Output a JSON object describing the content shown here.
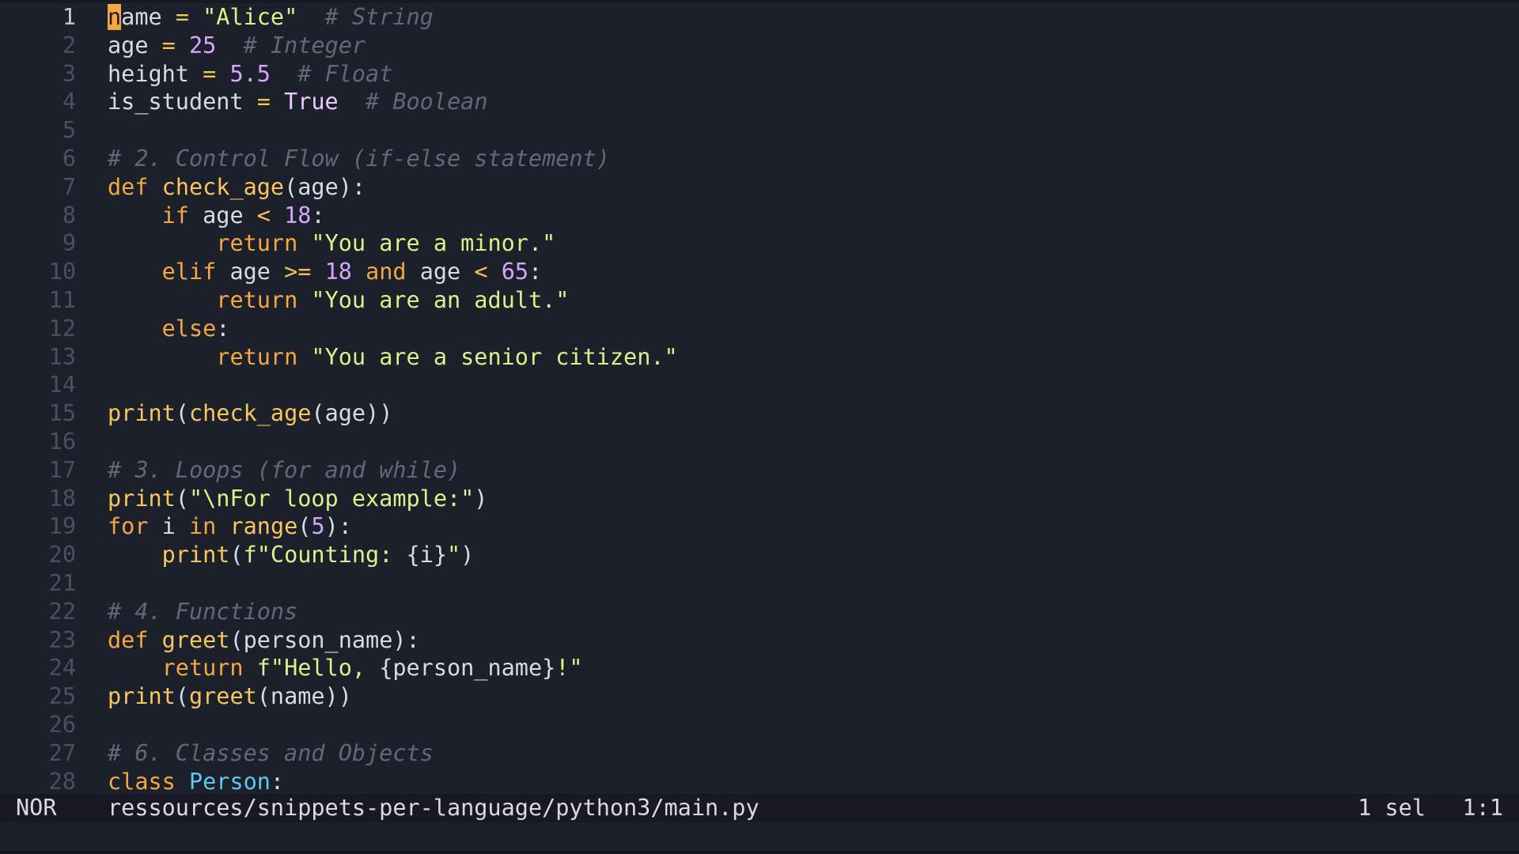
{
  "editor": {
    "lines": [
      {
        "n": "1",
        "tokens": [
          {
            "t": "n",
            "c": "cursor"
          },
          {
            "t": "ame",
            "c": "plain"
          },
          {
            "t": " = ",
            "c": "op"
          },
          {
            "t": "\"Alice\"",
            "c": "string"
          },
          {
            "t": "  ",
            "c": "plain"
          },
          {
            "t": "# String",
            "c": "comment"
          }
        ]
      },
      {
        "n": "2",
        "tokens": [
          {
            "t": "age",
            "c": "plain"
          },
          {
            "t": " = ",
            "c": "op"
          },
          {
            "t": "25",
            "c": "number"
          },
          {
            "t": "  ",
            "c": "plain"
          },
          {
            "t": "# Integer",
            "c": "comment"
          }
        ]
      },
      {
        "n": "3",
        "tokens": [
          {
            "t": "height",
            "c": "plain"
          },
          {
            "t": " = ",
            "c": "op"
          },
          {
            "t": "5.5",
            "c": "number"
          },
          {
            "t": "  ",
            "c": "plain"
          },
          {
            "t": "# Float",
            "c": "comment"
          }
        ]
      },
      {
        "n": "4",
        "tokens": [
          {
            "t": "is_student",
            "c": "plain"
          },
          {
            "t": " = ",
            "c": "op"
          },
          {
            "t": "True",
            "c": "const"
          },
          {
            "t": "  ",
            "c": "plain"
          },
          {
            "t": "# Boolean",
            "c": "comment"
          }
        ]
      },
      {
        "n": "5",
        "tokens": []
      },
      {
        "n": "6",
        "tokens": [
          {
            "t": "# 2. Control Flow (if-else statement)",
            "c": "comment"
          }
        ]
      },
      {
        "n": "7",
        "tokens": [
          {
            "t": "def",
            "c": "keyword"
          },
          {
            "t": " ",
            "c": "plain"
          },
          {
            "t": "check_age",
            "c": "func"
          },
          {
            "t": "(age):",
            "c": "plain"
          }
        ]
      },
      {
        "n": "8",
        "tokens": [
          {
            "t": "    ",
            "c": "plain"
          },
          {
            "t": "if",
            "c": "keyword"
          },
          {
            "t": " age ",
            "c": "plain"
          },
          {
            "t": "<",
            "c": "op"
          },
          {
            "t": " ",
            "c": "plain"
          },
          {
            "t": "18",
            "c": "number"
          },
          {
            "t": ":",
            "c": "plain"
          }
        ]
      },
      {
        "n": "9",
        "tokens": [
          {
            "t": "        ",
            "c": "plain"
          },
          {
            "t": "return",
            "c": "keyword"
          },
          {
            "t": " ",
            "c": "plain"
          },
          {
            "t": "\"You are a minor.\"",
            "c": "string"
          }
        ]
      },
      {
        "n": "10",
        "tokens": [
          {
            "t": "    ",
            "c": "plain"
          },
          {
            "t": "elif",
            "c": "keyword"
          },
          {
            "t": " age ",
            "c": "plain"
          },
          {
            "t": ">=",
            "c": "op"
          },
          {
            "t": " ",
            "c": "plain"
          },
          {
            "t": "18",
            "c": "number"
          },
          {
            "t": " ",
            "c": "plain"
          },
          {
            "t": "and",
            "c": "keyword"
          },
          {
            "t": " age ",
            "c": "plain"
          },
          {
            "t": "<",
            "c": "op"
          },
          {
            "t": " ",
            "c": "plain"
          },
          {
            "t": "65",
            "c": "number"
          },
          {
            "t": ":",
            "c": "plain"
          }
        ]
      },
      {
        "n": "11",
        "tokens": [
          {
            "t": "        ",
            "c": "plain"
          },
          {
            "t": "return",
            "c": "keyword"
          },
          {
            "t": " ",
            "c": "plain"
          },
          {
            "t": "\"You are an adult.\"",
            "c": "string"
          }
        ]
      },
      {
        "n": "12",
        "tokens": [
          {
            "t": "    ",
            "c": "plain"
          },
          {
            "t": "else",
            "c": "keyword"
          },
          {
            "t": ":",
            "c": "plain"
          }
        ]
      },
      {
        "n": "13",
        "tokens": [
          {
            "t": "        ",
            "c": "plain"
          },
          {
            "t": "return",
            "c": "keyword"
          },
          {
            "t": " ",
            "c": "plain"
          },
          {
            "t": "\"You are a senior citizen.\"",
            "c": "string"
          }
        ]
      },
      {
        "n": "14",
        "tokens": []
      },
      {
        "n": "15",
        "tokens": [
          {
            "t": "print",
            "c": "func"
          },
          {
            "t": "(",
            "c": "plain"
          },
          {
            "t": "check_age",
            "c": "func"
          },
          {
            "t": "(age))",
            "c": "plain"
          }
        ]
      },
      {
        "n": "16",
        "tokens": []
      },
      {
        "n": "17",
        "tokens": [
          {
            "t": "# 3. Loops (for and while)",
            "c": "comment"
          }
        ]
      },
      {
        "n": "18",
        "tokens": [
          {
            "t": "print",
            "c": "func"
          },
          {
            "t": "(",
            "c": "plain"
          },
          {
            "t": "\"\\nFor loop example:\"",
            "c": "string"
          },
          {
            "t": ")",
            "c": "plain"
          }
        ]
      },
      {
        "n": "19",
        "tokens": [
          {
            "t": "for",
            "c": "keyword"
          },
          {
            "t": " i ",
            "c": "plain"
          },
          {
            "t": "in",
            "c": "keyword"
          },
          {
            "t": " ",
            "c": "plain"
          },
          {
            "t": "range",
            "c": "func"
          },
          {
            "t": "(",
            "c": "plain"
          },
          {
            "t": "5",
            "c": "number"
          },
          {
            "t": "):",
            "c": "plain"
          }
        ]
      },
      {
        "n": "20",
        "tokens": [
          {
            "t": "    ",
            "c": "plain"
          },
          {
            "t": "print",
            "c": "func"
          },
          {
            "t": "(",
            "c": "plain"
          },
          {
            "t": "f\"Counting: ",
            "c": "string"
          },
          {
            "t": "{i}",
            "c": "plain"
          },
          {
            "t": "\"",
            "c": "string"
          },
          {
            "t": ")",
            "c": "plain"
          }
        ]
      },
      {
        "n": "21",
        "tokens": []
      },
      {
        "n": "22",
        "tokens": [
          {
            "t": "# 4. Functions",
            "c": "comment"
          }
        ]
      },
      {
        "n": "23",
        "tokens": [
          {
            "t": "def",
            "c": "keyword"
          },
          {
            "t": " ",
            "c": "plain"
          },
          {
            "t": "greet",
            "c": "func"
          },
          {
            "t": "(person_name):",
            "c": "plain"
          }
        ]
      },
      {
        "n": "24",
        "tokens": [
          {
            "t": "    ",
            "c": "plain"
          },
          {
            "t": "return",
            "c": "keyword"
          },
          {
            "t": " ",
            "c": "plain"
          },
          {
            "t": "f\"Hello, ",
            "c": "string"
          },
          {
            "t": "{person_name}",
            "c": "plain"
          },
          {
            "t": "!\"",
            "c": "string"
          }
        ]
      },
      {
        "n": "25",
        "tokens": [
          {
            "t": "print",
            "c": "func"
          },
          {
            "t": "(",
            "c": "plain"
          },
          {
            "t": "greet",
            "c": "func"
          },
          {
            "t": "(name))",
            "c": "plain"
          }
        ]
      },
      {
        "n": "26",
        "tokens": []
      },
      {
        "n": "27",
        "tokens": [
          {
            "t": "# 6. Classes and Objects",
            "c": "comment"
          }
        ]
      },
      {
        "n": "28",
        "tokens": [
          {
            "t": "class",
            "c": "keyword"
          },
          {
            "t": " ",
            "c": "plain"
          },
          {
            "t": "Person",
            "c": "class"
          },
          {
            "t": ":",
            "c": "plain"
          }
        ]
      }
    ]
  },
  "statusline": {
    "mode": "NOR",
    "file_path": "ressources/snippets-per-language/python3/main.py",
    "selection": "1 sel",
    "position": "1:1"
  },
  "colors": {
    "background": "#1c202b",
    "keyword": "#f5a742",
    "function": "#f7c65d",
    "string": "#d9f28a",
    "number": "#d6a6f8",
    "comment": "#626879",
    "class": "#5ec8f0",
    "cursor": "#f5a742"
  }
}
